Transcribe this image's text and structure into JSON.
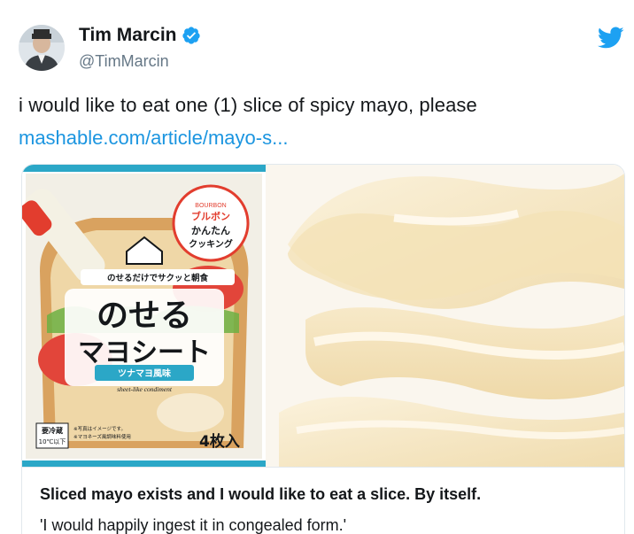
{
  "author": {
    "name": "Tim Marcin",
    "handle": "@TimMarcin"
  },
  "tweet": {
    "text": "i would like to eat one (1) slice of spicy mayo, please",
    "link_text": "mashable.com/article/mayo-s..."
  },
  "card": {
    "title": "Sliced mayo exists and I would like to eat a slice. By itself.",
    "description": "'I would happily ingest it in congealed form.'",
    "package": {
      "brand": "BOURBON",
      "badge_line1": "ブルボン",
      "badge_line2": "かんたん",
      "badge_line3": "クッキング",
      "tagline": "のせるだけでサクッと朝食",
      "title_line1": "のせる",
      "title_line2": "マヨシート",
      "flavor": "ツナマヨ風味",
      "subtitle": "sheet-like condiment",
      "storage_line1": "要冷蔵",
      "storage_line2": "10℃以下",
      "note_line1": "※写真はイメージです。",
      "note_line2": "※マヨネーズ風調味料使用",
      "count": "4枚入"
    }
  },
  "colors": {
    "link": "#1b95e0",
    "twitter_blue": "#1da1f2",
    "secondary_text": "#657786"
  },
  "icons": {
    "verified": "verified-badge-icon",
    "twitter": "twitter-bird-icon"
  }
}
